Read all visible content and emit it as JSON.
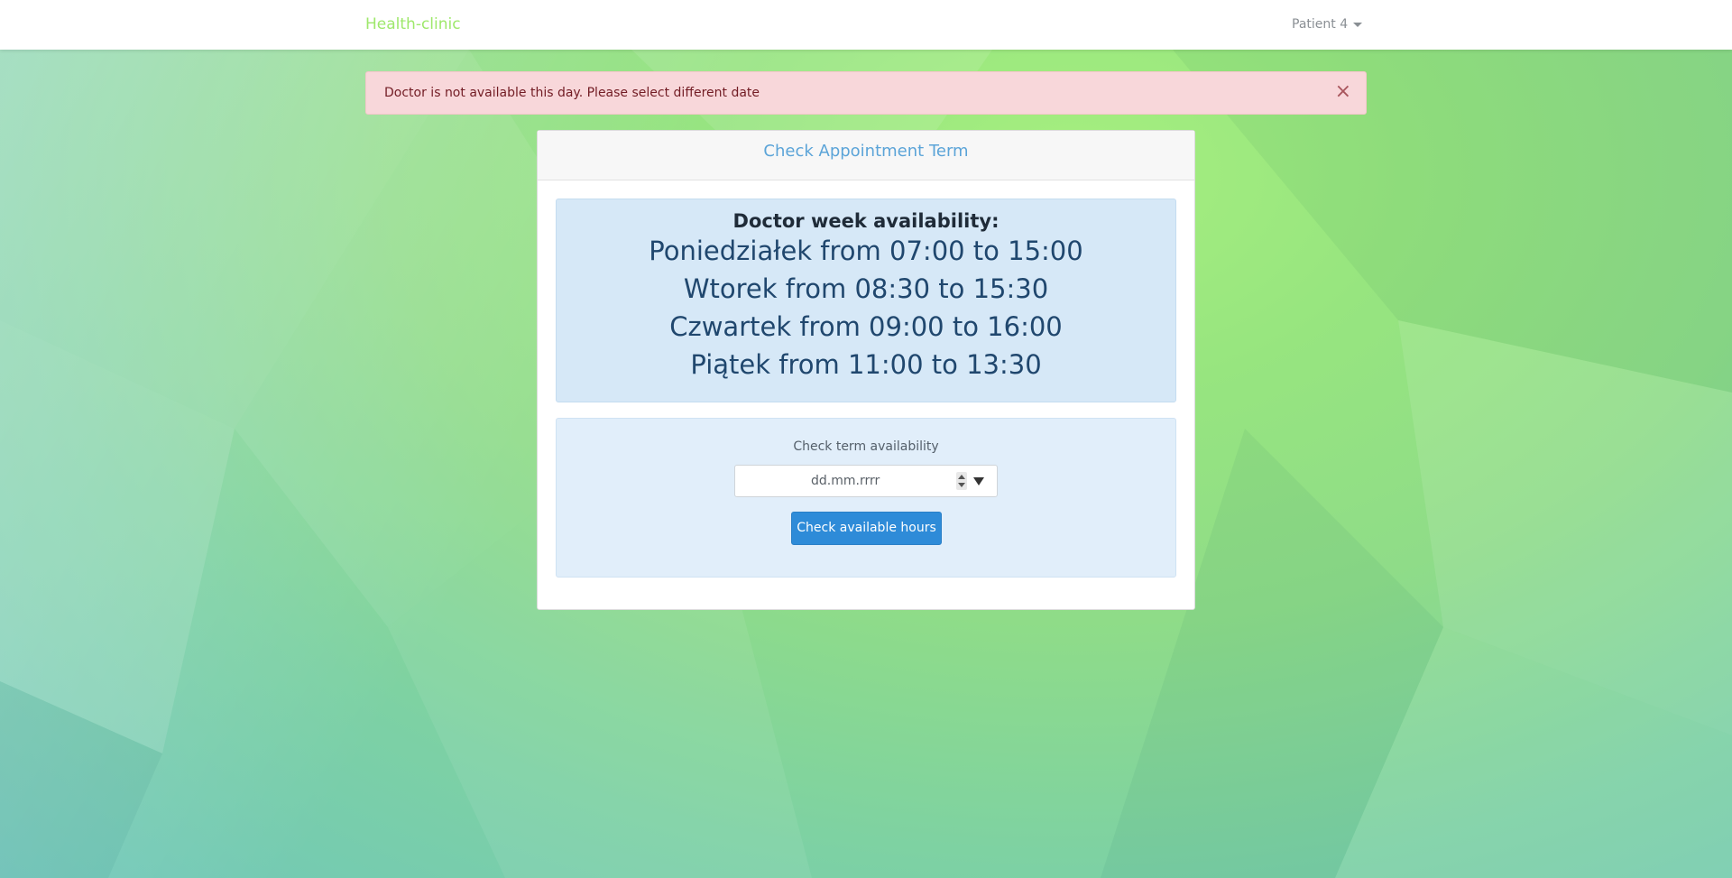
{
  "navbar": {
    "brand": "Health-clinic",
    "user_menu_label": "Patient 4"
  },
  "alert": {
    "message": "Doctor is not available this day. Please select different date",
    "close_symbol": "×"
  },
  "card": {
    "header": "Check Appointment Term",
    "availability": {
      "title": "Doctor week availability:",
      "lines": [
        "Poniedziałek from 07:00 to 15:00",
        "Wtorek from 08:30 to 15:30",
        "Czwartek from 09:00 to 16:00",
        "Piątek from 11:00 to 13:30"
      ]
    },
    "check": {
      "label": "Check term availability",
      "date_placeholder": "dd.mm.rrrr",
      "button_label": "Check available hours"
    }
  },
  "icons": {
    "user_menu": "caret-down-icon",
    "alert_close": "close-icon",
    "date_spin": "spinner-icon",
    "date_dropdown": "dropdown-arrow-icon"
  },
  "colors": {
    "brand": "#9ee86b",
    "alert_bg": "#f8d7da",
    "alert_text": "#721c24",
    "header_text": "#5ba4d8",
    "availability_bg": "#d6e8f7",
    "check_bg": "#e1eefa",
    "button_bg": "#2e8bd8"
  }
}
